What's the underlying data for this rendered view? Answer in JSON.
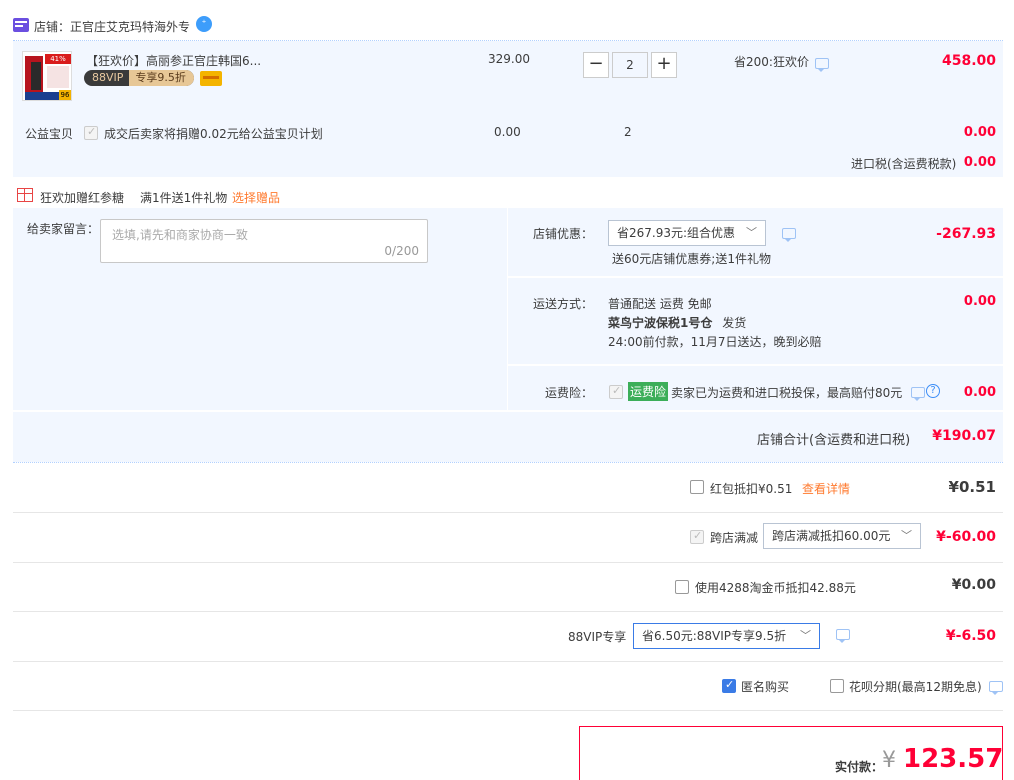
{
  "shop": {
    "label": "店铺：",
    "name": "正官庄艾克玛特海外专"
  },
  "item": {
    "title": "【狂欢价】高丽参正官庄韩国6...",
    "vip_badge": "88VIP",
    "vip_discount": "专享9.5折",
    "price": "329.00",
    "qty": "2",
    "promo": "省200:狂欢价",
    "subtotal": "458.00",
    "thumb_tag": "41%",
    "thumb_num": "96"
  },
  "charity": {
    "label": "公益宝贝",
    "text": "成交后卖家将捐赠0.02元给公益宝贝计划",
    "price": "0.00",
    "qty": "2",
    "subtotal": "0.00"
  },
  "import_tax": {
    "label": "进口税(含运费税款)",
    "value": "0.00"
  },
  "gift": {
    "label": "狂欢加赠红参糖",
    "rule": "满1件送1件礼物",
    "link": "选择赠品"
  },
  "message": {
    "label": "给卖家留言：",
    "placeholder": "选填,请先和商家协商一致",
    "counter": "0/200"
  },
  "shop_discount": {
    "label": "店铺优惠：",
    "selected": "省267.93元:组合优惠",
    "note": "送60元店铺优惠券;送1件礼物",
    "value": "-267.93"
  },
  "shipping": {
    "label": "运送方式：",
    "line1": "普通配送 运费 免邮",
    "warehouse": "菜鸟宁波保税1号仓",
    "ship": "发货",
    "line3": "24:00前付款，11月7日送达，晚到必赔",
    "value": "0.00"
  },
  "insurance": {
    "label": "运费险：",
    "badge": "运费险",
    "text": "卖家已为运费和进口税投保，最高赔付80元",
    "value": "0.00"
  },
  "shop_total": {
    "label": "店铺合计(含运费和进口税)",
    "value": "¥190.07"
  },
  "redpacket": {
    "label": "红包抵扣¥0.51",
    "link": "查看详情",
    "value": "¥0.51"
  },
  "cross_shop": {
    "label": "跨店满减",
    "selected": "跨店满减抵扣60.00元",
    "value": "¥-60.00"
  },
  "taobao_coin": {
    "label": "使用4288淘金币抵扣42.88元",
    "value": "¥0.00"
  },
  "vip88": {
    "label": "88VIP专享",
    "selected": "省6.50元:88VIP专享9.5折",
    "value": "¥-6.50"
  },
  "options": {
    "anonymous": "匿名购买",
    "huabei": "花呗分期(最高12期免息)"
  },
  "payable": {
    "label": "实付款：",
    "currency": "¥",
    "amount": "123.57"
  }
}
